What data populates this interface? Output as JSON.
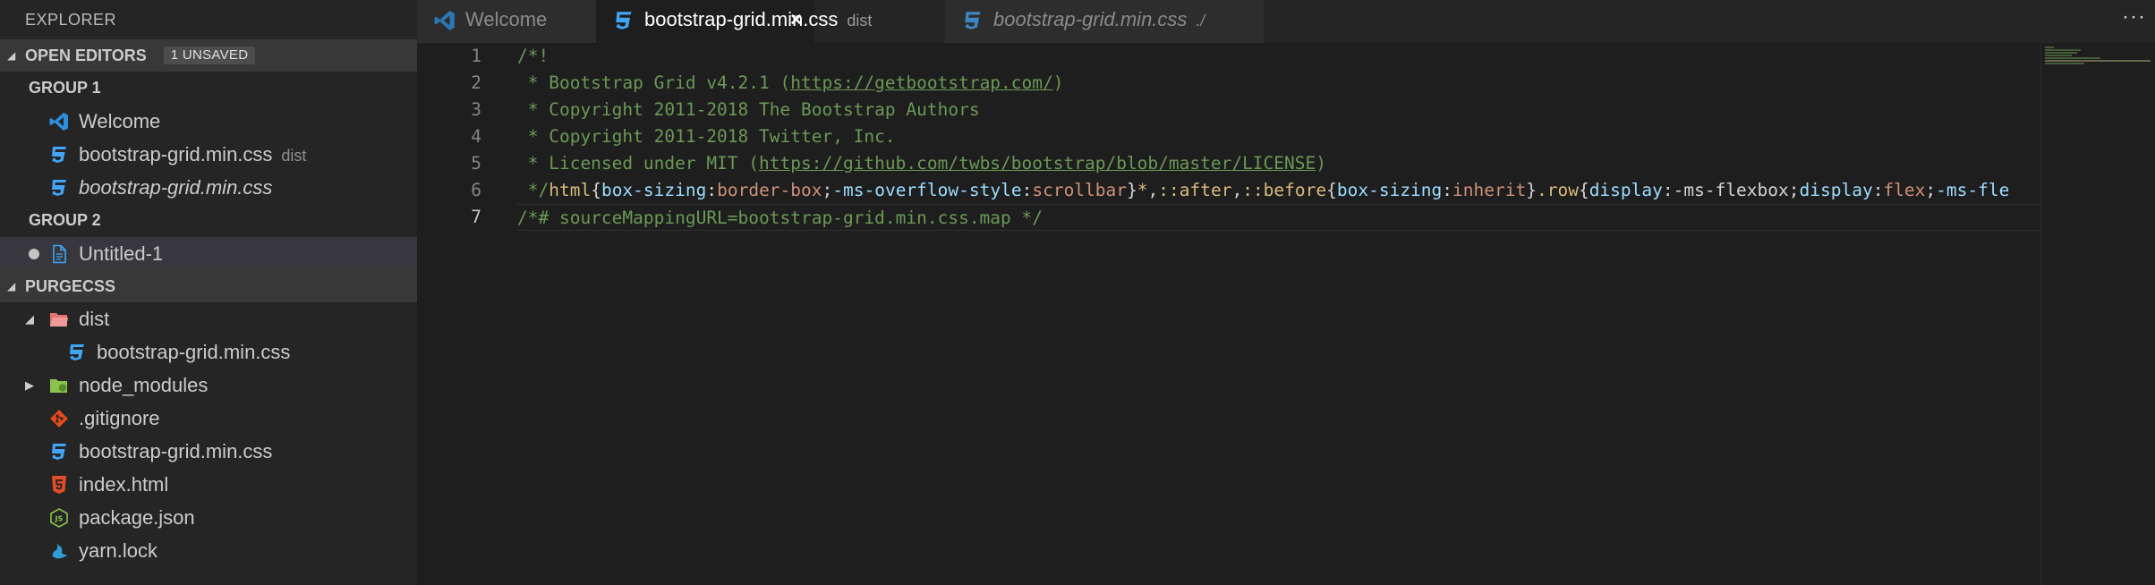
{
  "explorer": {
    "title": "EXPLORER",
    "open_editors": {
      "header": "OPEN EDITORS",
      "badge": "1 UNSAVED",
      "groups": [
        {
          "label": "GROUP 1",
          "items": [
            {
              "label": "Welcome",
              "description": "",
              "icon": "vscode-icon"
            },
            {
              "label": "bootstrap-grid.min.css",
              "description": "dist",
              "icon": "css-file-icon"
            },
            {
              "label": "bootstrap-grid.min.css",
              "description": "",
              "icon": "css-file-icon"
            }
          ]
        },
        {
          "label": "GROUP 2",
          "items": [
            {
              "label": "Untitled-1",
              "description": "",
              "icon": "file-icon",
              "unsaved": true
            }
          ]
        }
      ]
    },
    "workspace": {
      "header": "PURGECSS",
      "items": [
        {
          "label": "dist",
          "type": "folder",
          "expanded": true,
          "icon": "folder-open-icon"
        },
        {
          "label": "bootstrap-grid.min.css",
          "type": "file",
          "icon": "css-file-icon"
        },
        {
          "label": "node_modules",
          "type": "folder",
          "expanded": false,
          "icon": "node-folder-icon"
        },
        {
          "label": ".gitignore",
          "type": "file",
          "icon": "git-icon"
        },
        {
          "label": "bootstrap-grid.min.css",
          "type": "file",
          "icon": "css-file-icon"
        },
        {
          "label": "index.html",
          "type": "file",
          "icon": "html-file-icon"
        },
        {
          "label": "package.json",
          "type": "file",
          "icon": "json-file-icon"
        },
        {
          "label": "yarn.lock",
          "type": "file",
          "icon": "yarn-icon"
        }
      ]
    }
  },
  "tabs": [
    {
      "label": "Welcome",
      "description": "",
      "active": false
    },
    {
      "label": "bootstrap-grid.min.css",
      "description": "dist",
      "active": true,
      "close": "×"
    },
    {
      "label": "bootstrap-grid.min.css",
      "description": "./",
      "active": false
    }
  ],
  "more_actions": "···",
  "editor": {
    "line_numbers": [
      "1",
      "2",
      "3",
      "4",
      "5",
      "6",
      "7"
    ],
    "lines": {
      "l1": "/*!",
      "l2_a": " * Bootstrap Grid v4.2.1 (",
      "l2_link": "https://getbootstrap.com/",
      "l2_b": ")",
      "l3": " * Copyright 2011-2018 The Bootstrap Authors",
      "l4": " * Copyright 2011-2018 Twitter, Inc.",
      "l5_a": " * Licensed under MIT (",
      "l5_link": "https://github.com/twbs/bootstrap/blob/master/LICENSE",
      "l5_b": ")",
      "l6": {
        "c1": " */",
        "s1": "html",
        "p1": "{",
        "k1": "box-sizing",
        "p2": ":",
        "v1": "border-box",
        "p3": ";",
        "k2": "-ms-overflow-style",
        "p4": ":",
        "v2": "scrollbar",
        "p5": "}",
        "s2": "*",
        "p6": ",",
        "s3": "::after",
        "p7": ",",
        "s4": "::before",
        "p8": "{",
        "k3": "box-sizing",
        "p9": ":",
        "v3": "inherit",
        "p10": "}",
        "s5": ".row",
        "p11": "{",
        "k4": "display",
        "p12": ":-ms-flexbox;",
        "k5": "display",
        "p13": ":",
        "v4": "flex",
        "p14": ";",
        "k6": "-ms-fle"
      },
      "l7": "/*# sourceMappingURL=bootstrap-grid.min.css.map */"
    }
  },
  "colors": {
    "sidebar_bg": "#252526",
    "editor_bg": "#1e1e1e",
    "comment": "#6a9955",
    "selector": "#d7ba7d",
    "property": "#9cdcfe",
    "value": "#ce9178",
    "css_icon": "#42a5f5"
  }
}
